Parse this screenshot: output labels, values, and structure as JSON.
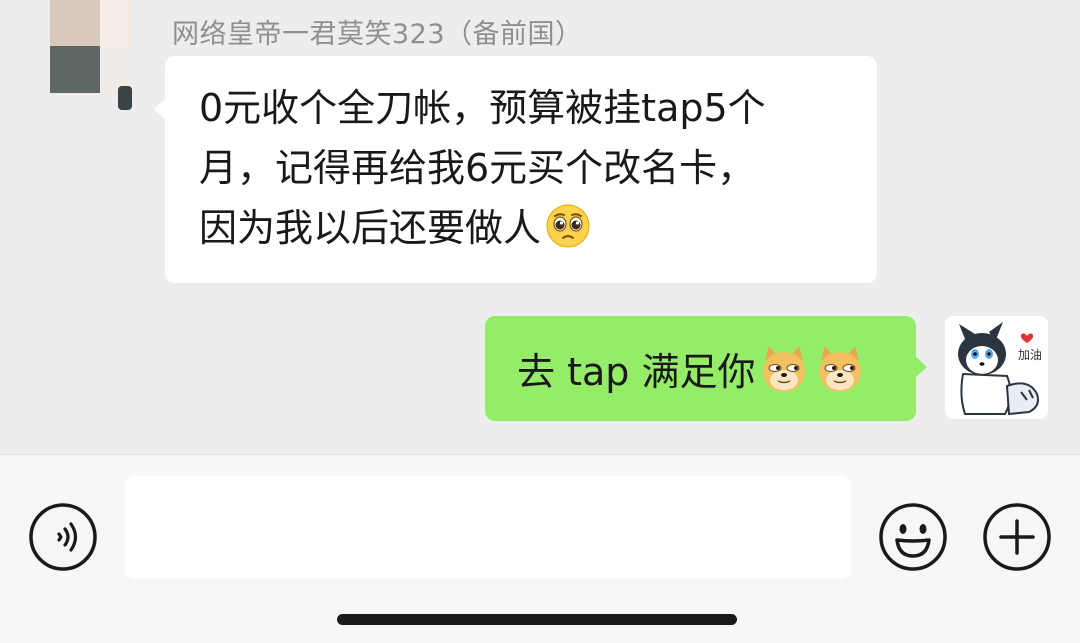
{
  "chat": {
    "sender_name": "网络皇帝一君莫笑323（备前国）",
    "incoming_message": {
      "lines": [
        "0元收个全刀帐，预算被挂tap5个",
        "月，记得再给我6元买个改名卡，",
        "因为我以后还要做人"
      ],
      "emoji": "pleading-face-emoji"
    },
    "outgoing_message": {
      "text": "去 tap 满足你",
      "emojis": [
        "doge-emoji",
        "doge-emoji"
      ]
    },
    "self_avatar_caption": "加油"
  },
  "input_bar": {
    "voice_icon": "voice-icon",
    "input_value": "",
    "emoji_icon": "smiley-face-icon",
    "plus_icon": "plus-circle-icon"
  },
  "colors": {
    "background": "#ededed",
    "incoming_bubble": "#ffffff",
    "outgoing_bubble": "#95ec69",
    "input_bar": "#f7f7f7",
    "sender_name": "#8f8f8f"
  }
}
